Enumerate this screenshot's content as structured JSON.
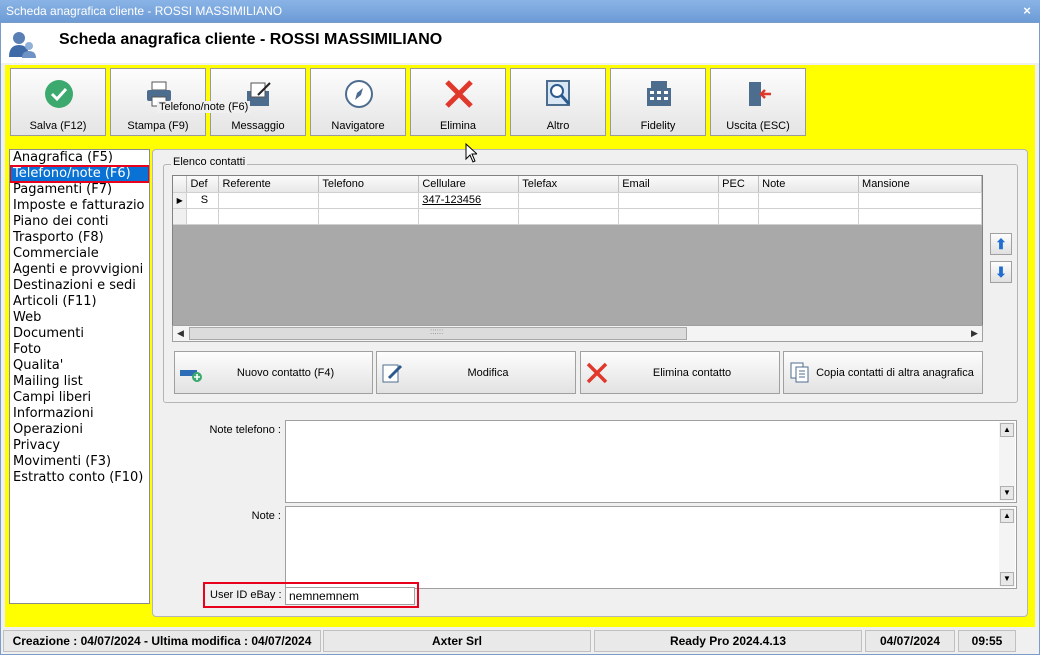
{
  "window": {
    "title": "Scheda anagrafica cliente - ROSSI MASSIMILIANO",
    "close": "×"
  },
  "header": {
    "title": "Scheda anagrafica cliente - ROSSI MASSIMILIANO"
  },
  "toolbar": [
    {
      "label": "Salva (F12)",
      "icon": "check-icon"
    },
    {
      "label": "Stampa (F9)",
      "icon": "printer-icon"
    },
    {
      "label": "Messaggio",
      "icon": "message-icon"
    },
    {
      "label": "Navigatore",
      "icon": "compass-icon"
    },
    {
      "label": "Elimina",
      "icon": "delete-icon"
    },
    {
      "label": "Altro",
      "icon": "search-doc-icon"
    },
    {
      "label": "Fidelity",
      "icon": "register-icon"
    },
    {
      "label": "Uscita (ESC)",
      "icon": "exit-icon"
    }
  ],
  "nav": {
    "items": [
      "Anagrafica (F5)",
      "Telefono/note (F6)",
      "Pagamenti (F7)",
      "Imposte e fatturazio",
      "Piano dei conti",
      "Trasporto (F8)",
      "Commerciale",
      "Agenti e provvigioni",
      "Destinazioni e sedi",
      "Articoli (F11)",
      "Web",
      "Documenti",
      "Foto",
      "Qualita'",
      "Mailing list",
      "Campi liberi",
      "Informazioni",
      "Operazioni",
      "Privacy",
      "Movimenti (F3)",
      "Estratto conto (F10)"
    ],
    "selected": 1
  },
  "panel": {
    "title": "Telefono/note (F6)",
    "group_title": "Elenco contatti"
  },
  "grid": {
    "columns": [
      "Def",
      "Referente",
      "Telefono",
      "Cellulare",
      "Telefax",
      "Email",
      "PEC",
      "Note",
      "Mansione"
    ],
    "rows": [
      [
        "S",
        "",
        "",
        "347-123456",
        "",
        "",
        "",
        "",
        ""
      ],
      [
        "",
        "",
        "",
        "",
        "",
        "",
        "",
        "",
        ""
      ]
    ],
    "grip": "::::::"
  },
  "actions": {
    "new": "Nuovo contatto (F4)",
    "edit": "Modifica",
    "delete": "Elimina contatto",
    "copy": "Copia contatti di altra anagrafica"
  },
  "fields": {
    "note_tel_label": "Note telefono :",
    "note_label": "Note :",
    "ebay_label": "User ID eBay :",
    "ebay_value": "nemnemnem"
  },
  "status": {
    "created": "Creazione : 04/07/2024 - Ultima modifica : 04/07/2024",
    "company": "Axter Srl",
    "product": "Ready Pro 2024.4.13",
    "date": "04/07/2024",
    "time": "09:55"
  }
}
